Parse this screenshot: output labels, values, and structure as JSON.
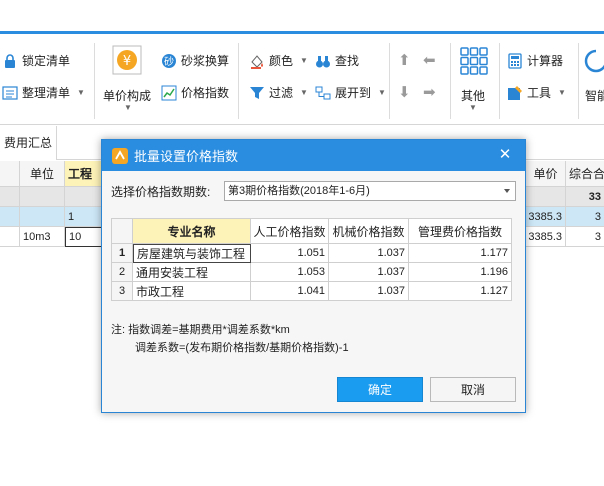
{
  "ribbon": {
    "lock_list": "锁定清单",
    "organize_list": "整理清单",
    "unit_price_structure": "单价构成",
    "mortar_conversion": "砂浆换算",
    "price_index": "价格指数",
    "color": "颜色",
    "find": "查找",
    "filter": "过滤",
    "expand_to": "展开到",
    "other": "其他",
    "calculator": "计算器",
    "tools": "工具",
    "smart": "智能"
  },
  "tabs": {
    "active": "费用汇总"
  },
  "grid": {
    "headers": {
      "unit": "单位",
      "engineering": "工程",
      "unit_price": "单价",
      "composite": "综合合"
    },
    "rows": [
      {
        "col_a": "",
        "col_b": "",
        "price": "",
        "comp": "33"
      },
      {
        "col_a": "",
        "col_b": "1",
        "price": "3385.3",
        "comp": "3"
      },
      {
        "col_a": "10m3",
        "col_b": "10",
        "price": "3385.3",
        "comp": "3"
      }
    ]
  },
  "dialog": {
    "title": "批量设置价格指数",
    "period_label": "选择价格指数期数:",
    "period_value": "第3期价格指数(2018年1-6月)",
    "columns": [
      "专业名称",
      "人工价格指数",
      "机械价格指数",
      "管理费价格指数"
    ],
    "rows": [
      {
        "idx": "1",
        "name": "房屋建筑与装饰工程",
        "labor": "1.051",
        "machine": "1.037",
        "mgmt": "1.177"
      },
      {
        "idx": "2",
        "name": "通用安装工程",
        "labor": "1.053",
        "machine": "1.037",
        "mgmt": "1.196"
      },
      {
        "idx": "3",
        "name": "市政工程",
        "labor": "1.041",
        "machine": "1.037",
        "mgmt": "1.127"
      }
    ],
    "note_line1": "注: 指数调差=基期费用*调差系数*km",
    "note_line2": "调差系数=(发布期价格指数/基期价格指数)-1",
    "ok": "确定",
    "cancel": "取消"
  },
  "colors": {
    "accent": "#2a8de0",
    "ok_button": "#1a9cf0",
    "header_highlight": "#fdf2b8",
    "selected_row": "#cde7f7",
    "group_row": "#e6e6e6"
  }
}
